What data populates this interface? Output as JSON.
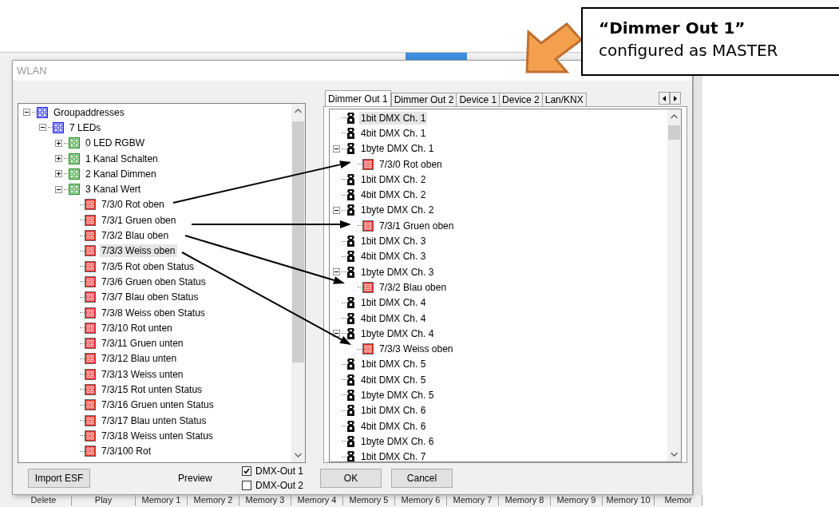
{
  "callout": {
    "title": "“Dimmer Out 1”",
    "text": "configured as MASTER"
  },
  "background_app": {
    "bottom_tabs": [
      "Delete",
      "Play",
      "Memory 1",
      "Memory 2",
      "Memory 3",
      "Memory 4",
      "Memory 5",
      "Memory 6",
      "Memory 7",
      "Memory 8",
      "Memory 9",
      "Memory 10",
      "Memor"
    ]
  },
  "dialog": {
    "title": "WLAN",
    "groupaddress_tree": [
      {
        "label": "Groupaddresses",
        "kind": "group",
        "color": "#1a1aff",
        "expanded": true,
        "selected": false,
        "children": [
          {
            "label": "7 LEDs",
            "kind": "group",
            "color": "#1a1aff",
            "expanded": true,
            "selected": false,
            "children": [
              {
                "label": "0 LED RGBW",
                "kind": "group",
                "color": "#1f8f1f",
                "expanded": false,
                "selected": false
              },
              {
                "label": "1 Kanal Schalten",
                "kind": "group",
                "color": "#1f8f1f",
                "expanded": false,
                "selected": false
              },
              {
                "label": "2 Kanal Dimmen",
                "kind": "group",
                "color": "#1f8f1f",
                "expanded": false,
                "selected": false
              },
              {
                "label": "3 Kanal Wert",
                "kind": "group",
                "color": "#1f8f1f",
                "expanded": true,
                "selected": false,
                "children": [
                  {
                    "label": "7/3/0 Rot oben",
                    "kind": "address",
                    "selected": false
                  },
                  {
                    "label": "7/3/1 Gruen oben",
                    "kind": "address",
                    "selected": false
                  },
                  {
                    "label": "7/3/2 Blau oben",
                    "kind": "address",
                    "selected": false
                  },
                  {
                    "label": "7/3/3 Weiss oben",
                    "kind": "address",
                    "selected": true
                  },
                  {
                    "label": "7/3/5 Rot oben Status",
                    "kind": "address",
                    "selected": false
                  },
                  {
                    "label": "7/3/6 Gruen oben Status",
                    "kind": "address",
                    "selected": false
                  },
                  {
                    "label": "7/3/7 Blau oben Status",
                    "kind": "address",
                    "selected": false
                  },
                  {
                    "label": "7/3/8 Weiss oben Status",
                    "kind": "address",
                    "selected": false
                  },
                  {
                    "label": "7/3/10 Rot unten",
                    "kind": "address",
                    "selected": false
                  },
                  {
                    "label": "7/3/11 Gruen unten",
                    "kind": "address",
                    "selected": false
                  },
                  {
                    "label": "7/3/12 Blau unten",
                    "kind": "address",
                    "selected": false
                  },
                  {
                    "label": "7/3/13 Weiss unten",
                    "kind": "address",
                    "selected": false
                  },
                  {
                    "label": "7/3/15 Rot unten Status",
                    "kind": "address",
                    "selected": false
                  },
                  {
                    "label": "7/3/16 Gruen unten Status",
                    "kind": "address",
                    "selected": false
                  },
                  {
                    "label": "7/3/17 Blau unten Status",
                    "kind": "address",
                    "selected": false
                  },
                  {
                    "label": "7/3/18 Weiss unten Status",
                    "kind": "address",
                    "selected": false
                  },
                  {
                    "label": "7/3/100 Rot",
                    "kind": "address",
                    "selected": false
                  }
                ]
              }
            ]
          }
        ]
      }
    ],
    "tabs": [
      {
        "label": "Dimmer Out 1",
        "selected": true
      },
      {
        "label": "Dimmer Out 2",
        "selected": false
      },
      {
        "label": "Device 1",
        "selected": false
      },
      {
        "label": "Device 2",
        "selected": false
      },
      {
        "label": "Lan/KNX",
        "selected": false
      }
    ],
    "device_tree": [
      {
        "label": "1bit DMX Ch. 1",
        "kind": "channel",
        "selected": true
      },
      {
        "label": "4bit DMX Ch. 1",
        "kind": "channel",
        "selected": false
      },
      {
        "label": "1byte DMX Ch. 1",
        "kind": "channel",
        "expanded": true,
        "selected": false,
        "children": [
          {
            "label": "7/3/0 Rot oben",
            "kind": "address",
            "selected": false
          }
        ]
      },
      {
        "label": "1bit DMX Ch. 2",
        "kind": "channel",
        "selected": false
      },
      {
        "label": "4bit DMX Ch. 2",
        "kind": "channel",
        "selected": false
      },
      {
        "label": "1byte DMX Ch. 2",
        "kind": "channel",
        "expanded": true,
        "selected": false,
        "children": [
          {
            "label": "7/3/1 Gruen oben",
            "kind": "address",
            "selected": false
          }
        ]
      },
      {
        "label": "1bit DMX Ch. 3",
        "kind": "channel",
        "selected": false
      },
      {
        "label": "4bit DMX Ch. 3",
        "kind": "channel",
        "selected": false
      },
      {
        "label": "1byte DMX Ch. 3",
        "kind": "channel",
        "expanded": true,
        "selected": false,
        "children": [
          {
            "label": "7/3/2 Blau oben",
            "kind": "address",
            "selected": false
          }
        ]
      },
      {
        "label": "1bit DMX Ch. 4",
        "kind": "channel",
        "selected": false
      },
      {
        "label": "4bit DMX Ch. 4",
        "kind": "channel",
        "selected": false
      },
      {
        "label": "1byte DMX Ch. 4",
        "kind": "channel",
        "expanded": true,
        "selected": false,
        "children": [
          {
            "label": "7/3/3 Weiss oben",
            "kind": "address",
            "selected": false
          }
        ]
      },
      {
        "label": "1bit DMX Ch. 5",
        "kind": "channel",
        "selected": false
      },
      {
        "label": "4bit DMX Ch. 5",
        "kind": "channel",
        "selected": false
      },
      {
        "label": "1byte DMX Ch. 5",
        "kind": "channel",
        "selected": false
      },
      {
        "label": "1bit DMX Ch. 6",
        "kind": "channel",
        "selected": false
      },
      {
        "label": "4bit DMX Ch. 6",
        "kind": "channel",
        "selected": false
      },
      {
        "label": "1byte DMX Ch. 6",
        "kind": "channel",
        "selected": false
      },
      {
        "label": "1bit DMX Ch. 7",
        "kind": "channel",
        "selected": false
      }
    ],
    "import_button": "Import ESF",
    "preview_label": "Preview",
    "outputs": [
      {
        "label": "DMX-Out 1",
        "checked": true
      },
      {
        "label": "DMX-Out 2",
        "checked": false
      }
    ],
    "buttons": [
      "OK",
      "Cancel"
    ]
  }
}
